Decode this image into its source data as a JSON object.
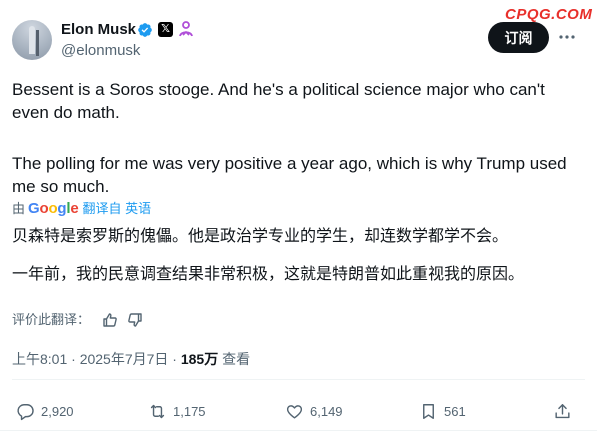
{
  "header": {
    "display_name": "Elon Musk",
    "handle": "@elonmusk",
    "follow_label": "订阅",
    "x_badge": "𝕏"
  },
  "watermark": "CPQG.COM",
  "tweet": {
    "paragraph_1": "Bessent is a Soros stooge. And he's a political science major who can't even do math.",
    "paragraph_2": "The polling for me was very positive a year ago, which is why Trump used me so much."
  },
  "translation": {
    "by_label": "由",
    "google_letters": [
      "G",
      "o",
      "o",
      "g",
      "l",
      "e"
    ],
    "google_colors": [
      "#4285F4",
      "#EA4335",
      "#FBBC05",
      "#4285F4",
      "#34A853",
      "#EA4335"
    ],
    "from_label": "翻译自 英语",
    "paragraph_1": "贝森特是索罗斯的傀儡。他是政治学专业的学生，却连数学都学不会。",
    "paragraph_2": "一年前，我的民意调查结果非常积极，这就是特朗普如此重视我的原因。",
    "rate_label": "评价此翻译："
  },
  "meta": {
    "time_date": "上午8:01 · 2025年7月7日 · ",
    "views_count": "185万",
    "views_label": " 查看"
  },
  "actions": {
    "replies": "2,920",
    "reposts": "1,175",
    "likes": "6,149",
    "bookmarks": "561"
  },
  "colors": {
    "accent": "#1d9bf0",
    "text": "#0f1419",
    "muted": "#536471",
    "watermark": "#e8302b",
    "affiliate": "#b04fd8"
  }
}
